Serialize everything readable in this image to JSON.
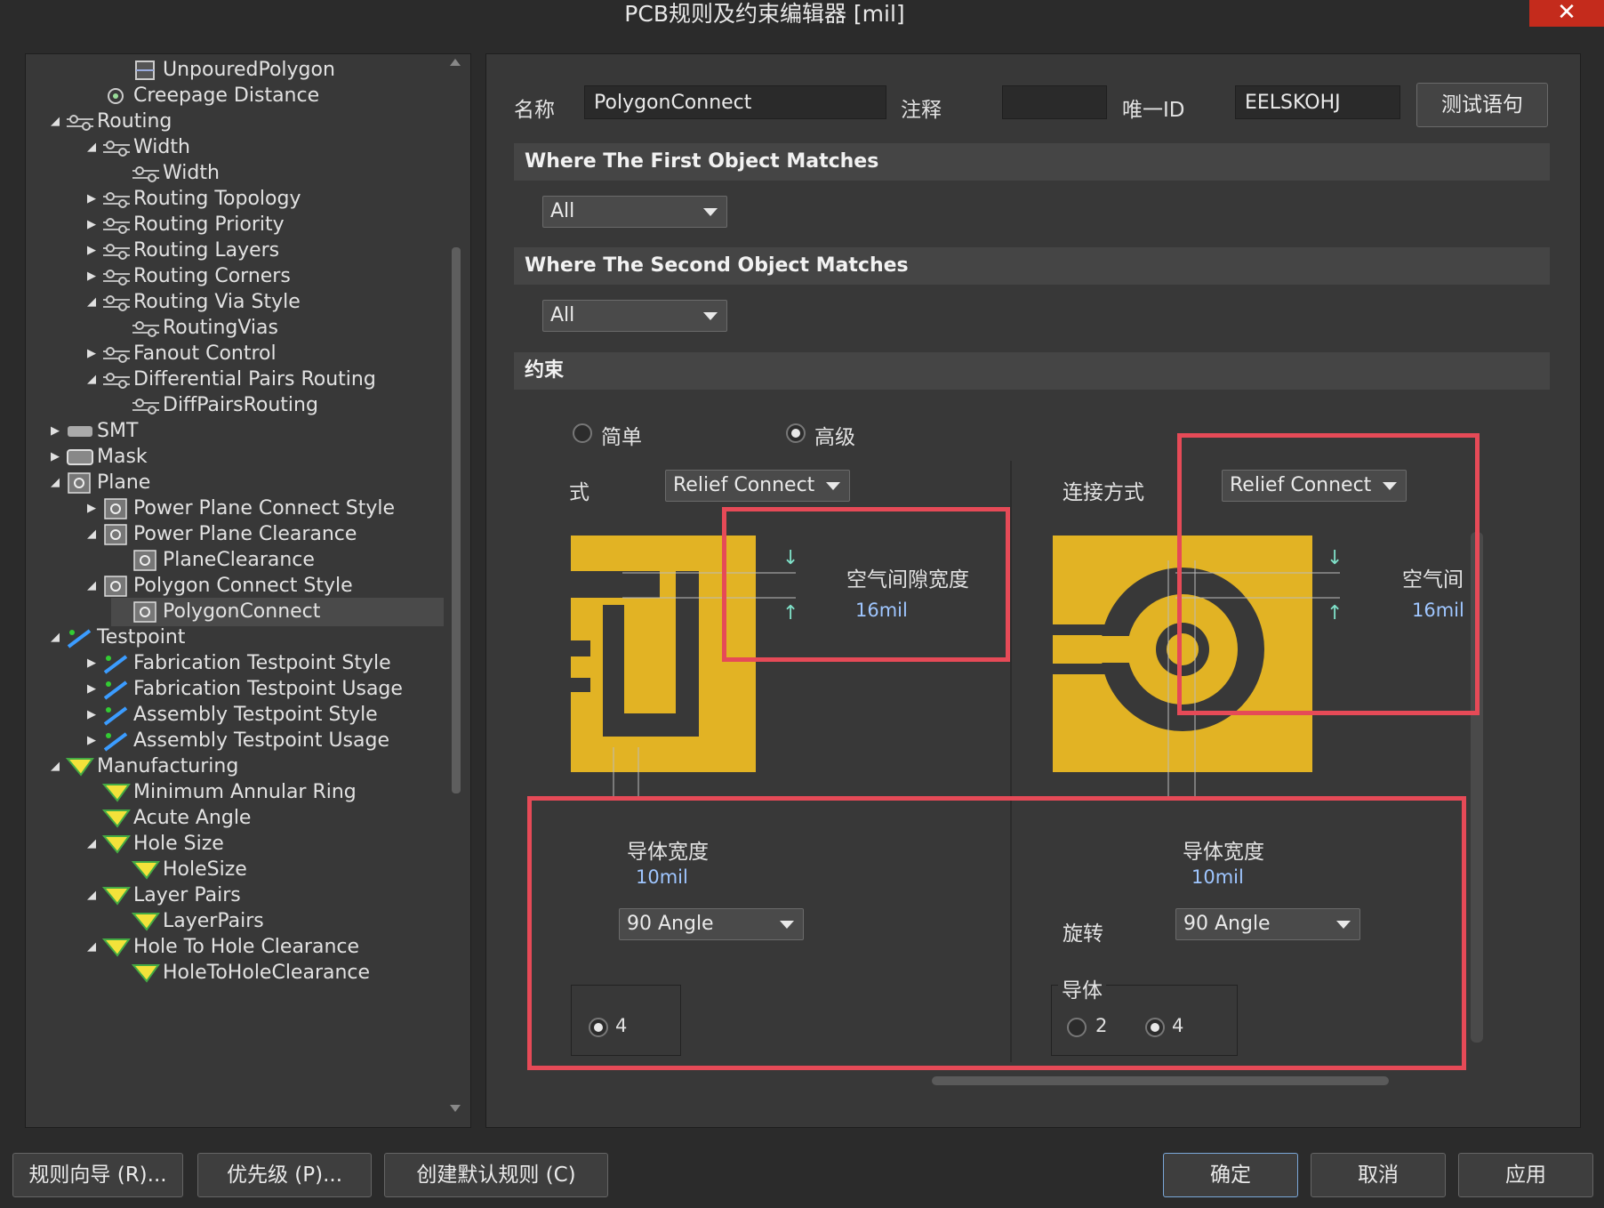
{
  "window": {
    "title": "PCB规则及约束编辑器 [mil]",
    "close": "✕"
  },
  "tree": {
    "items": [
      {
        "label": "UnpouredPolygon",
        "icon": "polygon-rule-icon"
      },
      {
        "label": "Creepage Distance",
        "icon": "clearance-rule-icon"
      },
      {
        "label": "Routing",
        "icon": "routing-rule-icon",
        "expanded": true
      },
      {
        "label": "Width",
        "icon": "routing-rule-icon",
        "expanded": true
      },
      {
        "label": "Width",
        "icon": "routing-rule-icon"
      },
      {
        "label": "Routing Topology",
        "icon": "routing-rule-icon",
        "expanded": false
      },
      {
        "label": "Routing Priority",
        "icon": "routing-rule-icon",
        "expanded": false
      },
      {
        "label": "Routing Layers",
        "icon": "routing-rule-icon",
        "expanded": false
      },
      {
        "label": "Routing Corners",
        "icon": "routing-rule-icon",
        "expanded": false
      },
      {
        "label": "Routing Via Style",
        "icon": "routing-rule-icon",
        "expanded": true
      },
      {
        "label": "RoutingVias",
        "icon": "routing-rule-icon"
      },
      {
        "label": "Fanout Control",
        "icon": "routing-rule-icon",
        "expanded": false
      },
      {
        "label": "Differential Pairs Routing",
        "icon": "routing-rule-icon",
        "expanded": true
      },
      {
        "label": "DiffPairsRouting",
        "icon": "routing-rule-icon"
      },
      {
        "label": "SMT",
        "icon": "smt-rule-icon",
        "expanded": false
      },
      {
        "label": "Mask",
        "icon": "mask-rule-icon",
        "expanded": false
      },
      {
        "label": "Plane",
        "icon": "plane-rule-icon",
        "expanded": true
      },
      {
        "label": "Power Plane Connect Style",
        "icon": "plane-rule-icon",
        "expanded": false
      },
      {
        "label": "Power Plane Clearance",
        "icon": "plane-rule-icon",
        "expanded": true
      },
      {
        "label": "PlaneClearance",
        "icon": "plane-rule-icon"
      },
      {
        "label": "Polygon Connect Style",
        "icon": "plane-rule-icon",
        "expanded": true
      },
      {
        "label": "PolygonConnect",
        "icon": "plane-rule-icon",
        "selected": true
      },
      {
        "label": "Testpoint",
        "icon": "testpoint-rule-icon",
        "expanded": true
      },
      {
        "label": "Fabrication Testpoint Style",
        "icon": "testpoint-rule-icon",
        "expanded": false
      },
      {
        "label": "Fabrication Testpoint Usage",
        "icon": "testpoint-rule-icon",
        "expanded": false
      },
      {
        "label": "Assembly Testpoint Style",
        "icon": "testpoint-rule-icon",
        "expanded": false
      },
      {
        "label": "Assembly Testpoint Usage",
        "icon": "testpoint-rule-icon",
        "expanded": false
      },
      {
        "label": "Manufacturing",
        "icon": "manufacturing-rule-icon",
        "expanded": true
      },
      {
        "label": "Minimum Annular Ring",
        "icon": "manufacturing-rule-icon"
      },
      {
        "label": "Acute Angle",
        "icon": "manufacturing-rule-icon"
      },
      {
        "label": "Hole Size",
        "icon": "manufacturing-rule-icon",
        "expanded": true
      },
      {
        "label": "HoleSize",
        "icon": "manufacturing-rule-icon"
      },
      {
        "label": "Layer Pairs",
        "icon": "manufacturing-rule-icon",
        "expanded": true
      },
      {
        "label": "LayerPairs",
        "icon": "manufacturing-rule-icon"
      },
      {
        "label": "Hole To Hole Clearance",
        "icon": "manufacturing-rule-icon",
        "expanded": true
      },
      {
        "label": "HoleToHoleClearance",
        "icon": "manufacturing-rule-icon"
      }
    ]
  },
  "rule": {
    "name_label": "名称",
    "name_value": "PolygonConnect",
    "comment_label": "注释",
    "comment_value": "",
    "uid_label": "唯一ID",
    "uid_value": "EELSKOHJ",
    "test_button": "测试语句"
  },
  "first_match": {
    "header": "Where The First Object Matches",
    "value": "All"
  },
  "second_match": {
    "header": "Where The Second Object Matches",
    "value": "All"
  },
  "constraints": {
    "header": "约束",
    "mode_simple": "简单",
    "mode_advanced": "高级",
    "left": {
      "connect_label": "式",
      "connect_value": "Relief Connect",
      "air_gap_label": "空气间隙宽度",
      "air_gap_value": "16mil",
      "conductor_width_label": "导体宽度",
      "conductor_width_value": "10mil",
      "rotation_value": "90 Angle",
      "conductor_option_4": "4"
    },
    "right": {
      "connect_label": "连接方式",
      "connect_value": "Relief Connect",
      "air_gap_label": "空气间",
      "air_gap_value": "16mil",
      "conductor_width_label": "导体宽度",
      "conductor_width_value": "10mil",
      "rotation_label": "旋转",
      "rotation_value": "90 Angle",
      "conductors_label": "导体",
      "conductor_option_2": "2",
      "conductor_option_4": "4"
    }
  },
  "footer": {
    "wizard": "规则向导 (R)...",
    "priority": "优先级 (P)...",
    "create_default": "创建默认规则 (C)",
    "ok": "确定",
    "cancel": "取消",
    "apply": "应用"
  },
  "colors": {
    "copper": "#e2b324",
    "highlight": "#e64a57",
    "value_text": "#9fc6ff"
  }
}
